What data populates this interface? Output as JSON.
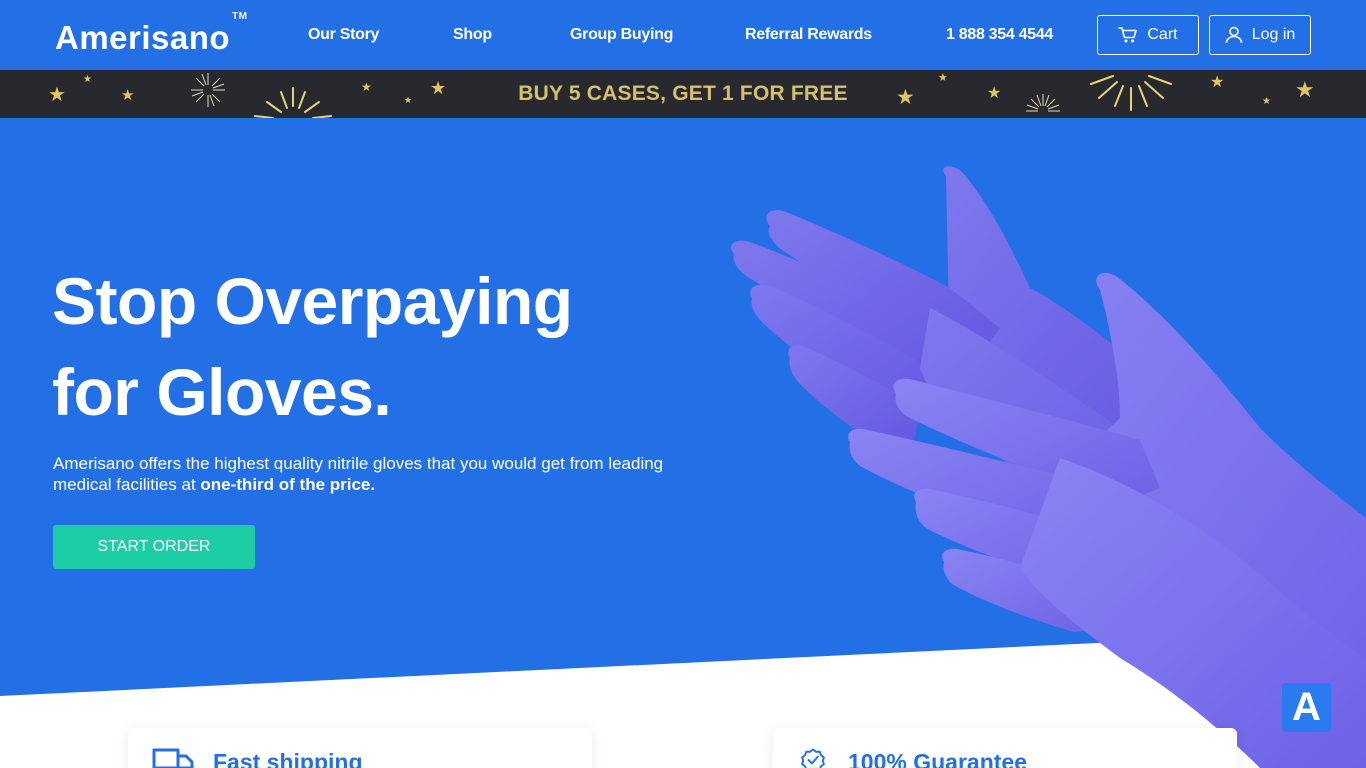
{
  "brand": {
    "name": "Amerisano",
    "tm": "TM"
  },
  "nav": {
    "our_story": "Our Story",
    "shop": "Shop",
    "group_buying": "Group Buying",
    "referral_rewards": "Referral Rewards",
    "phone": "1 888 354 4544",
    "cart": "Cart",
    "login": "Log in"
  },
  "promo": {
    "text": "BUY 5 CASES, GET 1 FOR FREE"
  },
  "hero": {
    "title_line1": "Stop Overpaying",
    "title_line2": "for Gloves.",
    "desc_main": "Amerisano offers the highest quality nitrile gloves that you would get from leading medical facilities at ",
    "desc_bold": "one-third of the price.",
    "cta": "START ORDER"
  },
  "features": [
    {
      "title": "Fast shipping",
      "icon": "truck-icon"
    },
    {
      "title": "100% Guarantee",
      "icon": "badge-check-icon"
    }
  ],
  "widget": {
    "letter": "A"
  },
  "colors": {
    "primary": "#2370e6",
    "promo_bg": "#27292e",
    "promo_text": "#d7c069",
    "cta": "#1ccda5",
    "glove": "#7a72ee"
  }
}
